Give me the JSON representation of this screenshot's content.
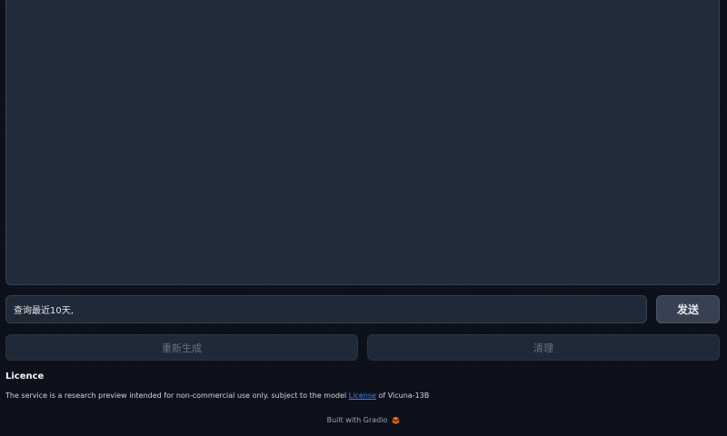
{
  "chat": {
    "input_value": "查询最近10天,",
    "send_label": "发送"
  },
  "actions": {
    "regenerate_label": "重新生成",
    "clear_label": "清理"
  },
  "licence": {
    "title": "Licence",
    "text_before": "The service is a research preview intended for non-commercial use only. subject to the model ",
    "link_text": "License",
    "text_after": " of Vicuna-13B"
  },
  "footer": {
    "built_with": "Built with Gradio",
    "logo_icon": "gradio-logo-icon"
  },
  "colors": {
    "background": "#0b0f19",
    "panel": "#1f2937",
    "link": "#3b82f6",
    "gradio_orange": "#f97316"
  }
}
